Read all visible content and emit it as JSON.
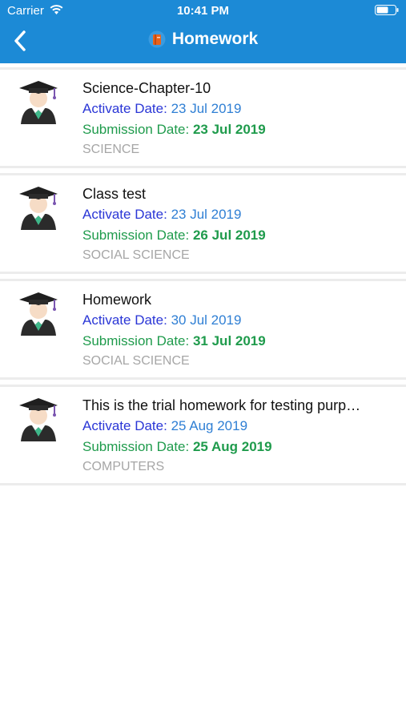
{
  "status_bar": {
    "carrier": "Carrier",
    "time": "10:41 PM"
  },
  "nav": {
    "title": "Homework",
    "back_icon": "chevron-left-icon",
    "title_icon": "book-icon"
  },
  "colors": {
    "header_bg": "#1c8ad6",
    "activate_label": "#2a36d6",
    "activate_value": "#2f7fd4",
    "submission": "#1f9b4c",
    "subject": "#a6a6a6"
  },
  "items": [
    {
      "title": "Science-Chapter-10",
      "activate_label": "Activate Date:",
      "activate_date": "23 Jul 2019",
      "submission_label": "Submission Date:",
      "submission_date": "23 Jul 2019",
      "subject": "SCIENCE",
      "avatar_icon": "graduate-avatar-icon"
    },
    {
      "title": "Class test",
      "activate_label": "Activate Date:",
      "activate_date": "23 Jul 2019",
      "submission_label": "Submission Date:",
      "submission_date": "26 Jul 2019",
      "subject": "SOCIAL SCIENCE",
      "avatar_icon": "graduate-avatar-icon"
    },
    {
      "title": "Homework",
      "activate_label": "Activate Date:",
      "activate_date": "30 Jul 2019",
      "submission_label": "Submission Date:",
      "submission_date": "31 Jul 2019",
      "subject": "SOCIAL SCIENCE",
      "avatar_icon": "graduate-avatar-icon"
    },
    {
      "title": "This is the trial homework for testing purp…",
      "activate_label": "Activate Date:",
      "activate_date": "25 Aug 2019",
      "submission_label": "Submission Date:",
      "submission_date": "25 Aug 2019",
      "subject": "COMPUTERS",
      "avatar_icon": "graduate-avatar-icon"
    }
  ]
}
